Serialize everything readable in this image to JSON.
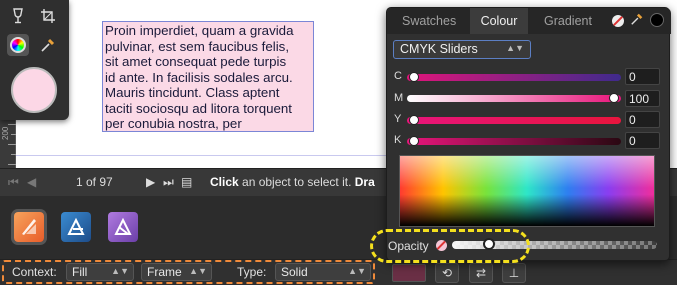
{
  "document": {
    "frame_text": "Proin imperdiet, quam a gravida\npulvinar, est sem faucibus felis,\nsit amet consequat pede turpis\nid ante. In facilisis sodales arcu.\nMauris tincidunt. Class aptent\ntaciti sociosqu ad litora torquent\nper conubia nostra, per",
    "ruler_label": "200",
    "frame_fill": "#fbd9e6"
  },
  "tools": {
    "items": [
      "wine-glass-icon",
      "crop-icon",
      "colour-wheel-icon",
      "colour-picker-icon"
    ],
    "current_colour": "#fcd7e6"
  },
  "status": {
    "page": "1 of 97",
    "hint_bold": "Click",
    "hint_text": " an object to select it. ",
    "hint_bold2": "Dra"
  },
  "personas": [
    "publisher-persona-icon",
    "designer-persona-icon",
    "photo-persona-icon"
  ],
  "context_bar": {
    "context_label": "Context:",
    "context_value": "Fill",
    "frame_value": "Frame",
    "type_label": "Type:",
    "type_value": "Solid",
    "fill_swatch": "#6a2f45"
  },
  "colour_panel": {
    "tabs": {
      "swatches": "Swatches",
      "colour": "Colour",
      "gradient": "Gradient"
    },
    "model": "CMYK Sliders",
    "sliders": {
      "c": {
        "label": "C",
        "value": "0",
        "level": 0
      },
      "m": {
        "label": "M",
        "value": "100",
        "level": 1
      },
      "y": {
        "label": "Y",
        "value": "0",
        "level": 0
      },
      "k": {
        "label": "K",
        "value": "0",
        "level": 0
      }
    },
    "opacity": {
      "label": "Opacity",
      "level": 0.18
    }
  },
  "colors": {
    "accent_highlight_yellow": "#f4e01e",
    "accent_highlight_orange": "#f08a3a"
  }
}
